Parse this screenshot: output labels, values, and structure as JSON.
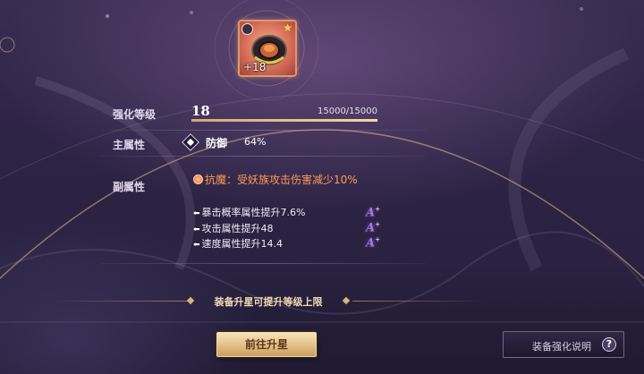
{
  "item": {
    "enhance_badge": "+18",
    "icon": "ring-icon"
  },
  "enhance_level": {
    "label": "强化等级",
    "value": "18",
    "exp_text": "15000/15000",
    "progress": 1.0
  },
  "main_attribute": {
    "label": "主属性",
    "icon": "shield-icon",
    "name": "防御",
    "value": "64%"
  },
  "sub_attributes": {
    "label": "副属性",
    "special": {
      "icon": "special-effect-icon",
      "text": "抗魔：受妖族攻击伤害减少10%"
    },
    "items": [
      {
        "text": "暴击概率属性提升7.6%",
        "grade": "A"
      },
      {
        "text": "攻击属性提升48",
        "grade": "A"
      },
      {
        "text": "速度属性提升14.4",
        "grade": "A"
      }
    ],
    "grade_plus": "+"
  },
  "tip": {
    "text": "装备升星可提升等级上限"
  },
  "buttons": {
    "star_up": "前往升星",
    "help": "装备强化说明",
    "help_icon": "?"
  },
  "colors": {
    "special_text": "#ff9a55",
    "grade": "#a977e8",
    "button_gold": "#e1bf86"
  }
}
